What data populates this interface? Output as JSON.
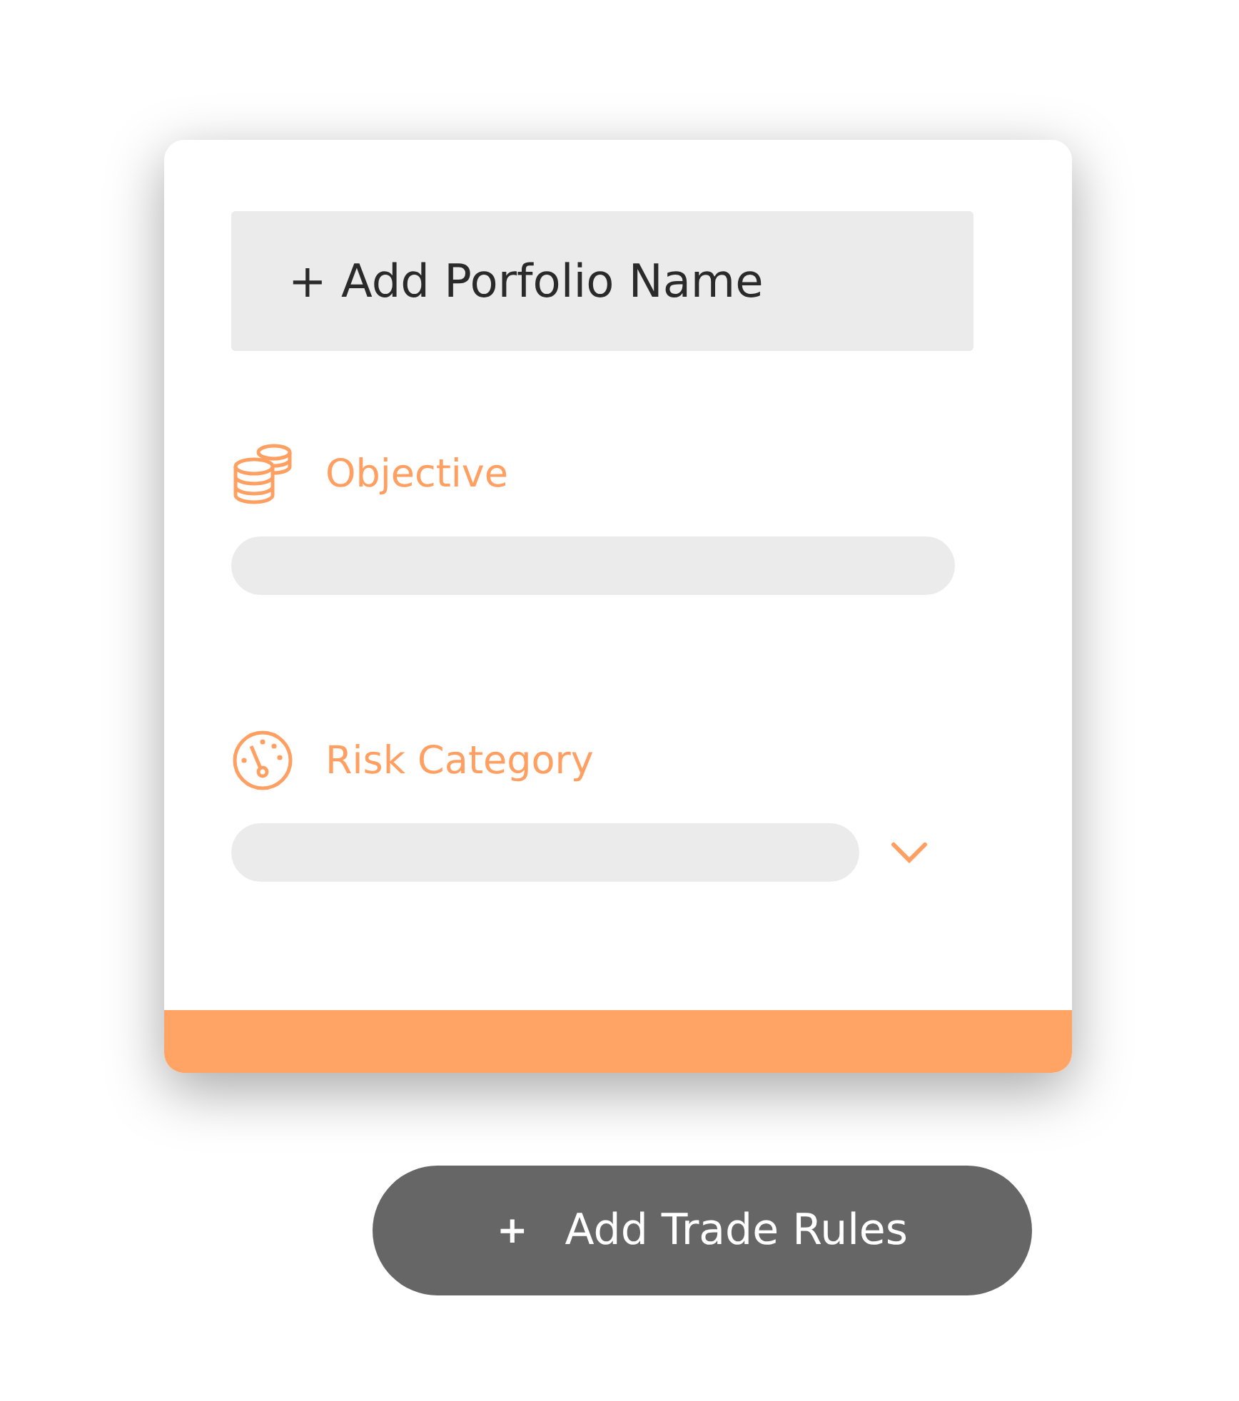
{
  "card": {
    "name_button": "+ Add Porfolio Name",
    "fields": [
      {
        "kind": "text",
        "label": "Objective"
      },
      {
        "kind": "select",
        "label": "Risk Category"
      }
    ]
  },
  "action_button": {
    "icon": "+",
    "label": "Add Trade Rules"
  }
}
